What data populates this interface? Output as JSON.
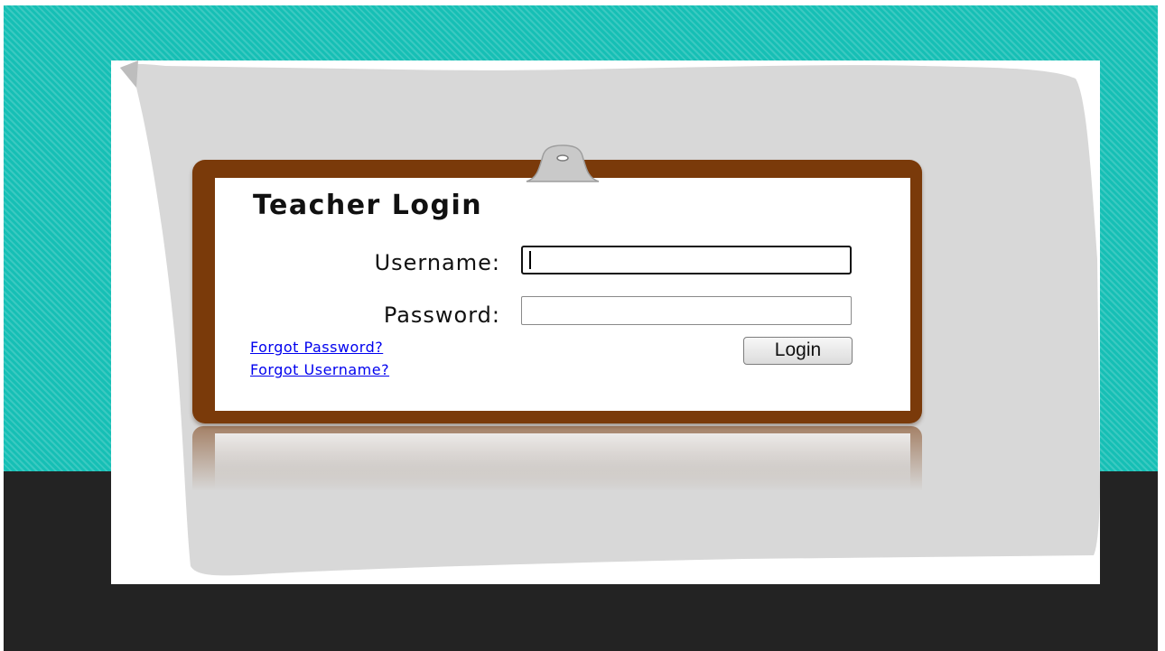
{
  "login_form": {
    "title": "Teacher Login",
    "username_label": "Username:",
    "username_value": "",
    "password_label": "Password:",
    "password_value": "",
    "forgot_password_link": "Forgot Password?",
    "forgot_username_link": "Forgot Username?",
    "login_button": "Login"
  },
  "colors": {
    "teal_background": "#16bfb5",
    "dark_background": "#232323",
    "clipboard_brown": "#7a3a0a",
    "paper_gray": "#d8d8d8",
    "link_blue": "#0000ee"
  },
  "icons": {
    "clipboard_clip": "clipboard-clip-icon"
  }
}
